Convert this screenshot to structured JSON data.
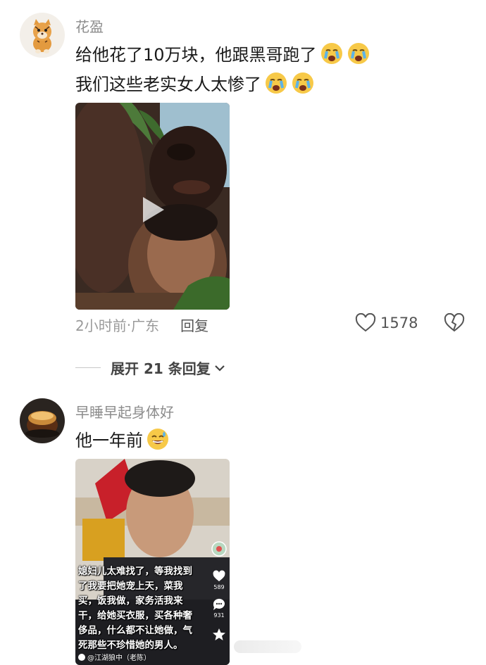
{
  "comments": [
    {
      "username": "花盈",
      "lines": [
        "给他花了10万块，他跟黑哥跑了",
        "我们这些老实女人太惨了"
      ],
      "line_emojis": [
        "crying-face-icon",
        "crying-face-icon"
      ],
      "media": {
        "type": "video"
      },
      "time": "2小时前",
      "separator": "·",
      "location": "广东",
      "reply_label": "回复",
      "like_count": "1578",
      "expand_label": "展开 21 条回复"
    },
    {
      "username": "早睡早起身体好",
      "lines": [
        "他一年前"
      ],
      "line_emojis": [
        "grinning-sweat-face-icon"
      ],
      "media": {
        "type": "video",
        "caption": "媳妇儿太难找了，等我找到了我要把她宠上天，菜我买，饭我做，家务活我来干，给她买衣服，买各种奢侈品，什么都不让她做，气死那些不珍惜她的男人。",
        "side_counts": [
          "589",
          "931"
        ],
        "watermark": "@江湖狼中（老陈）"
      }
    }
  ],
  "colors": {
    "username": "#8c8c8c",
    "meta": "#9a9a9a",
    "text": "#1a1a1a"
  }
}
